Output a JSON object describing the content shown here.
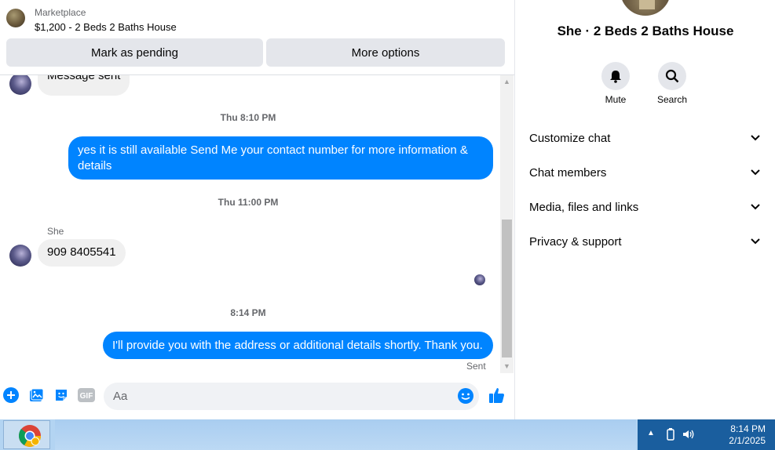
{
  "listing": {
    "source": "Marketplace",
    "title": "$1,200 - 2 Beds 2 Baths House",
    "pending_button": "Mark as pending",
    "options_button": "More options"
  },
  "thread": {
    "partial_message": "Message sent",
    "timestamps": [
      "Thu 8:10 PM",
      "Thu 11:00 PM",
      "8:14 PM"
    ],
    "outgoing_1": "yes it is still available Send Me your contact number for more information & details",
    "sender_name": "She",
    "incoming_1": "909 8405541",
    "outgoing_2": "I'll provide you with the address or additional details shortly. Thank you.",
    "status": "Sent"
  },
  "composer": {
    "placeholder": "Aa",
    "gif_label": "GIF"
  },
  "info": {
    "name": "She · 2 Beds 2 Baths House",
    "actions": [
      {
        "label": "Mute",
        "icon": "bell-icon"
      },
      {
        "label": "Search",
        "icon": "search-icon"
      }
    ],
    "sections": [
      "Customize chat",
      "Chat members",
      "Media, files and links",
      "Privacy & support"
    ]
  },
  "taskbar": {
    "time": "8:14 PM",
    "date": "2/1/2025"
  },
  "colors": {
    "messenger_blue": "#0084ff",
    "incoming_bubble": "#f0f0f0",
    "button_gray": "#e4e6eb",
    "taskbar": "#b3d4f2",
    "tray": "#1a5e9e"
  }
}
